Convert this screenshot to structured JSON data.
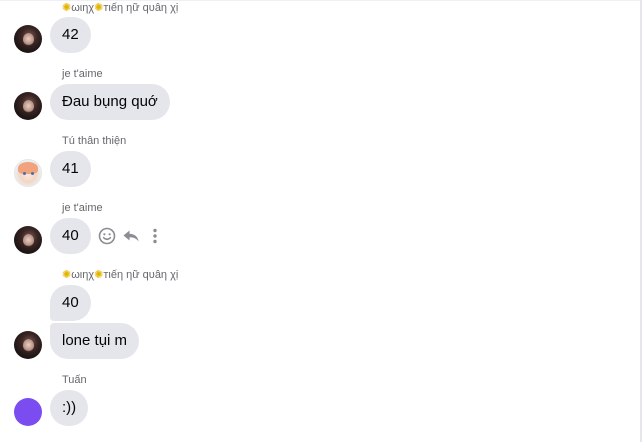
{
  "messages": [
    {
      "sender": "",
      "text": "42"
    },
    {
      "sender": "je t'aime",
      "text": "Đau bụng quớ"
    },
    {
      "sender": "Tú thân thiện",
      "text": "41"
    },
    {
      "sender": "je t'aime",
      "text": "40"
    },
    {
      "sender_parts": [
        "ωιηχ",
        "тιếη ηữ qυâη χị"
      ],
      "texts": [
        "40",
        "lone tụi m"
      ]
    },
    {
      "sender": "Tuấn",
      "text": ":))"
    }
  ],
  "top_sender_parts": [
    "ωιηχ",
    "тιếη ηữ qυâη χị"
  ],
  "hover_actions": [
    "react-icon",
    "reply-icon",
    "more-icon"
  ],
  "colors": {
    "bubble": "#e4e6eb",
    "meta_text": "#65676b",
    "avatar_purple": "#7b4df0",
    "star": "#e4b400"
  }
}
